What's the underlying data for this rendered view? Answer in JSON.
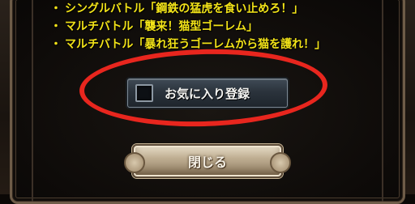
{
  "dialog": {
    "lines": [
      {
        "bullet": "・",
        "text": "シングルバトル「鋼鉄の猛虎を食い止めろ！」"
      },
      {
        "bullet": "・",
        "text": "マルチバトル「襲来！猫型ゴーレム」"
      },
      {
        "bullet": "・",
        "text": "マルチバトル「暴れ狂うゴーレムから猫を護れ！」"
      }
    ],
    "favorite_label": "お気に入り登録",
    "favorite_checked": false,
    "close_label": "閉じる"
  },
  "colors": {
    "text_yellow": "#f2e318",
    "highlight_red": "#e8261e",
    "panel_border": "#6e5c48"
  }
}
